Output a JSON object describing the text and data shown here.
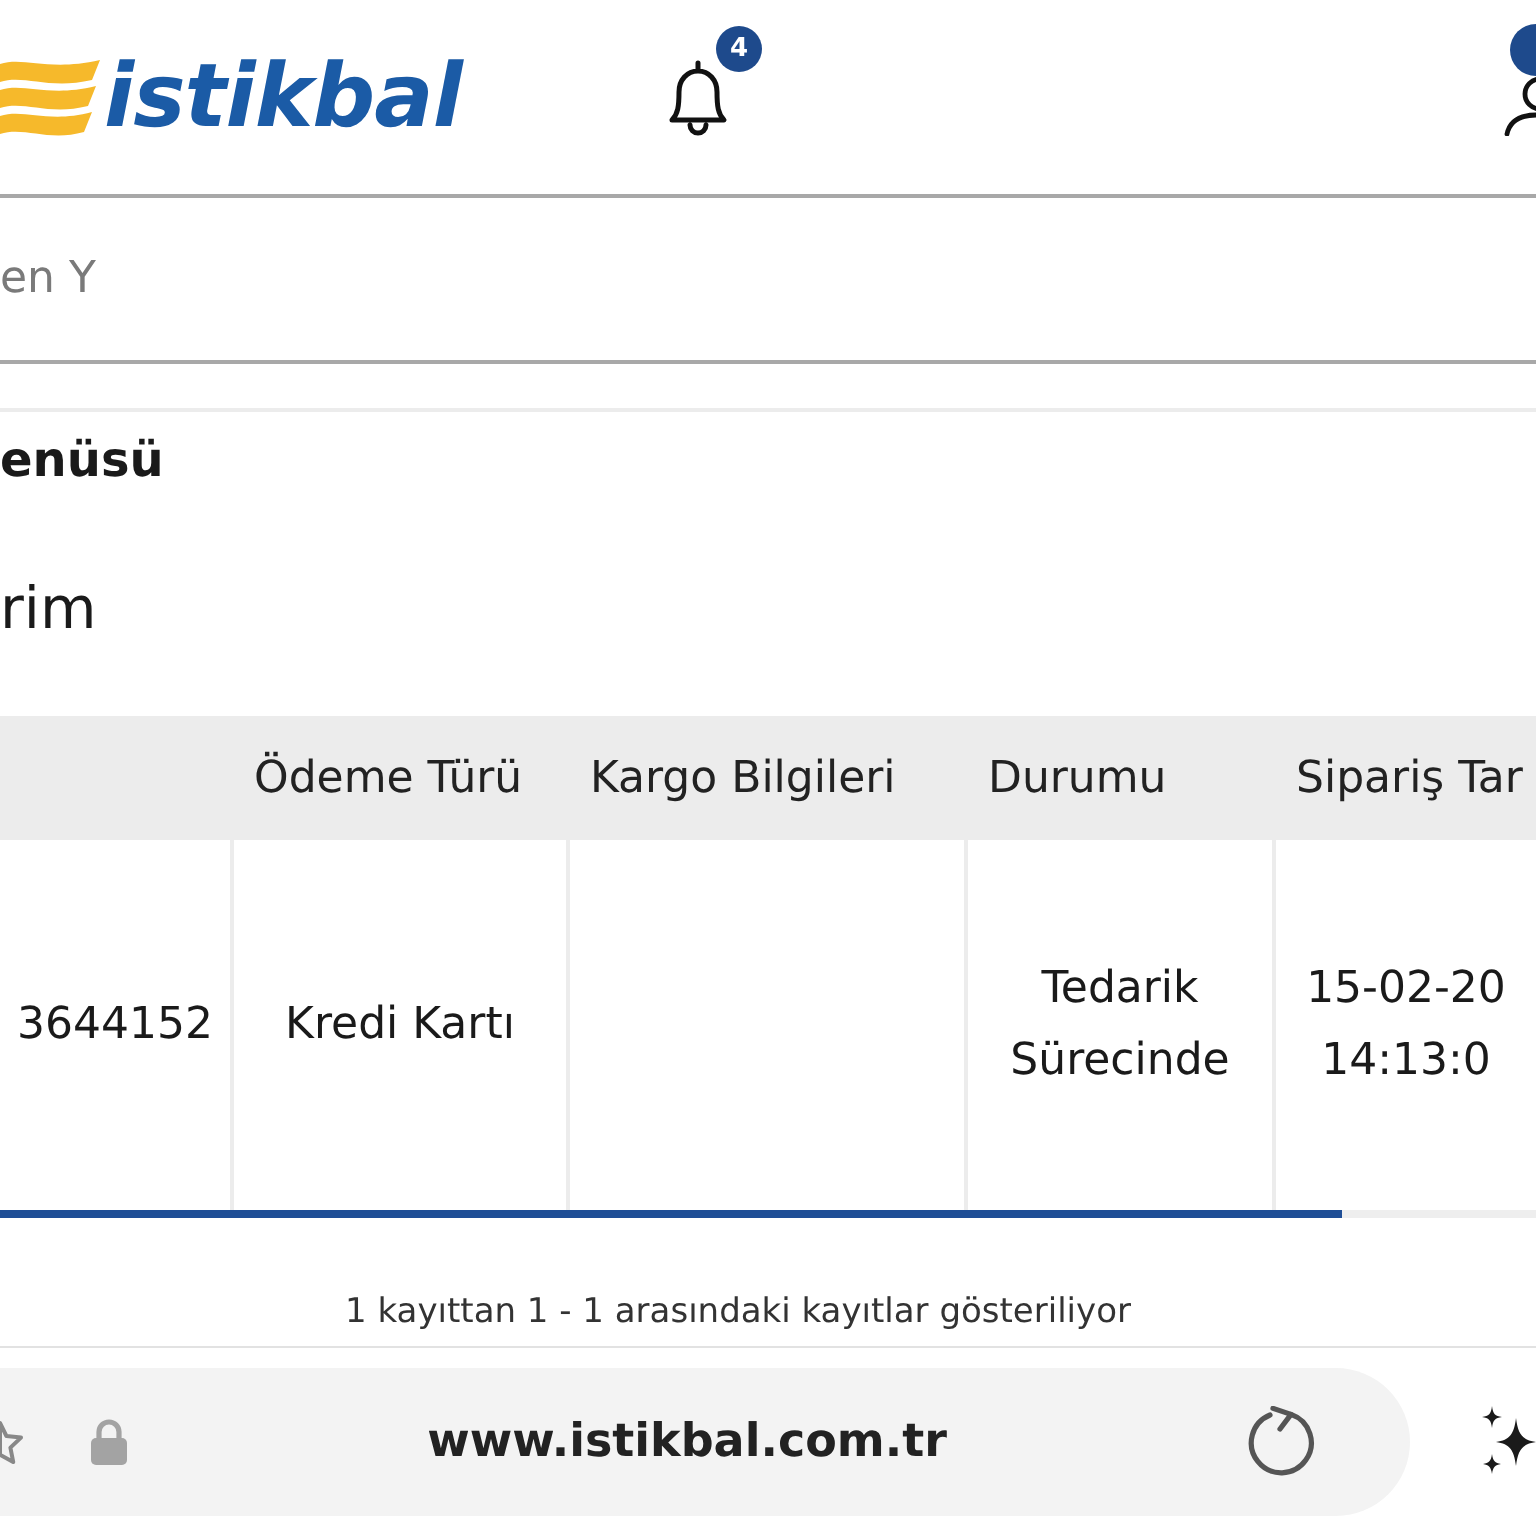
{
  "header": {
    "logo_text": "istikbal",
    "notification_count": "4"
  },
  "search": {
    "placeholder": "en Y"
  },
  "menu_heading": "enüsü",
  "page_title": "rim",
  "table": {
    "columns": [
      null,
      "Ödeme Türü",
      "Kargo Bilgileri",
      "Durumu",
      "Sipariş Tar"
    ],
    "rows": [
      {
        "cells": [
          "3644152",
          "Kredi Kartı",
          null,
          "Tedarik Sürecinde",
          "15-02-20 14:13:0"
        ]
      }
    ]
  },
  "pagination_info": "1 kayıttan 1 - 1 arasındaki kayıtlar gösteriliyor",
  "browser_bar": {
    "url": "www.istikbal.com.tr"
  }
}
